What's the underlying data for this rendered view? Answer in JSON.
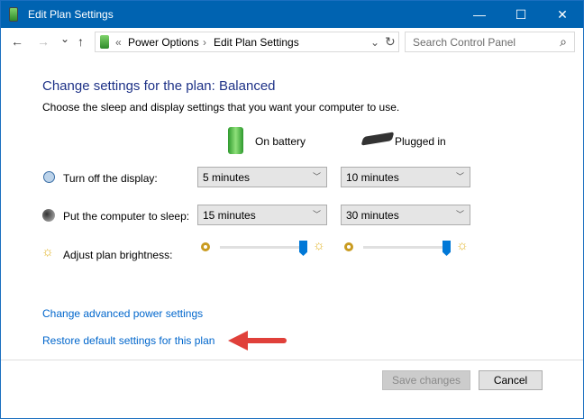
{
  "window": {
    "title": "Edit Plan Settings",
    "minimize": "—",
    "maximize": "☐",
    "close": "✕"
  },
  "nav": {
    "back": "←",
    "forward": "→",
    "recent": "⌄",
    "up": "↑"
  },
  "address": {
    "sep": "«",
    "crumbs": [
      "Power Options",
      "Edit Plan Settings"
    ],
    "arrow": "›",
    "dropdown": "⌄",
    "refresh": "↻"
  },
  "search": {
    "placeholder": "Search Control Panel",
    "icon": "⌕"
  },
  "main": {
    "heading": "Change settings for the plan: Balanced",
    "subheading": "Choose the sleep and display settings that you want your computer to use.",
    "columns": [
      "On battery",
      "Plugged in"
    ],
    "rows": [
      {
        "label": "Turn off the display:",
        "battery": "5 minutes",
        "plugged": "10 minutes"
      },
      {
        "label": "Put the computer to sleep:",
        "battery": "15 minutes",
        "plugged": "30 minutes"
      }
    ],
    "brightness": {
      "label": "Adjust plan brightness:",
      "battery_percent": 100,
      "plugged_percent": 100
    }
  },
  "links": {
    "advanced": "Change advanced power settings",
    "restore": "Restore default settings for this plan"
  },
  "buttons": {
    "save": "Save changes",
    "cancel": "Cancel"
  },
  "colors": {
    "titlebar": "#0063b1",
    "link": "#0066cc",
    "heading": "#1e3287",
    "arrow": "#e0403a"
  }
}
